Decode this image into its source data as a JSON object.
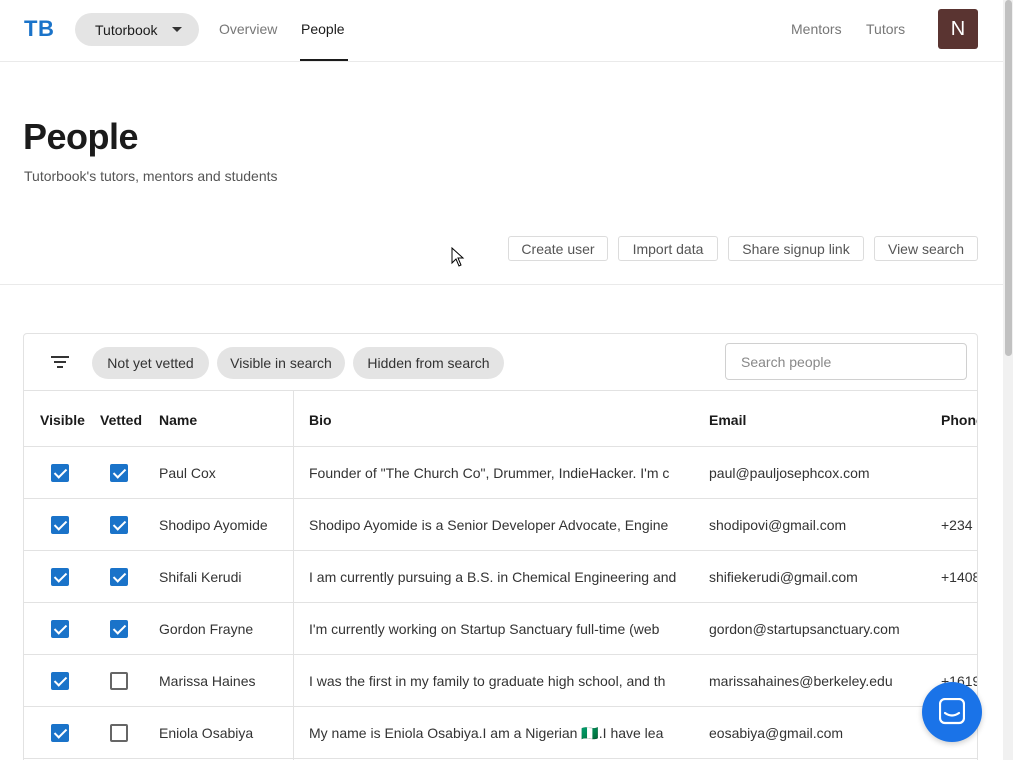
{
  "header": {
    "logo": "TB",
    "org": "Tutorbook",
    "tabs": [
      {
        "label": "Overview"
      },
      {
        "label": "People"
      }
    ],
    "right_links": [
      {
        "label": "Mentors"
      },
      {
        "label": "Tutors"
      }
    ],
    "avatar_initial": "N"
  },
  "page": {
    "title": "People",
    "subtitle": "Tutorbook's tutors, mentors and students",
    "actions": [
      "Create user",
      "Import data",
      "Share signup link",
      "View search"
    ]
  },
  "filters": {
    "chips": [
      "Not yet vetted",
      "Visible in search",
      "Hidden from search"
    ],
    "search_placeholder": "Search people"
  },
  "table": {
    "columns": [
      "Visible",
      "Vetted",
      "Name",
      "Bio",
      "Email",
      "Phone"
    ],
    "rows": [
      {
        "visible": true,
        "vetted": true,
        "name": "Paul Cox",
        "bio": "Founder of \"The Church Co\", Drummer, IndieHacker.  I'm c",
        "email": "paul@pauljosephcox.com",
        "phone": ""
      },
      {
        "visible": true,
        "vetted": true,
        "name": "Shodipo Ayomide",
        "bio": "Shodipo Ayomide is a Senior Developer Advocate, Engine",
        "email": "shodipovi@gmail.com",
        "phone": "+234"
      },
      {
        "visible": true,
        "vetted": true,
        "name": "Shifali Kerudi",
        "bio": "I am currently pursuing a B.S. in Chemical Engineering and",
        "email": "shifiekerudi@gmail.com",
        "phone": "+1408"
      },
      {
        "visible": true,
        "vetted": true,
        "name": "Gordon Frayne",
        "bio": "I'm currently working on Startup Sanctuary full-time (web",
        "email": "gordon@startupsanctuary.com",
        "phone": ""
      },
      {
        "visible": true,
        "vetted": false,
        "name": "Marissa Haines",
        "bio": "I was the first in my family to graduate high school, and th",
        "email": "marissahaines@berkeley.edu",
        "phone": "+1619"
      },
      {
        "visible": true,
        "vetted": false,
        "name": "Eniola Osabiya",
        "bio": "My name is Eniola Osabiya.I am a Nigerian 🇳🇬.I have lea",
        "email": "eosabiya@gmail.com",
        "phone": "+"
      }
    ]
  },
  "colors": {
    "brand": "#1a73c9",
    "avatar_bg": "#5a3431",
    "chat": "#1a73e8"
  }
}
